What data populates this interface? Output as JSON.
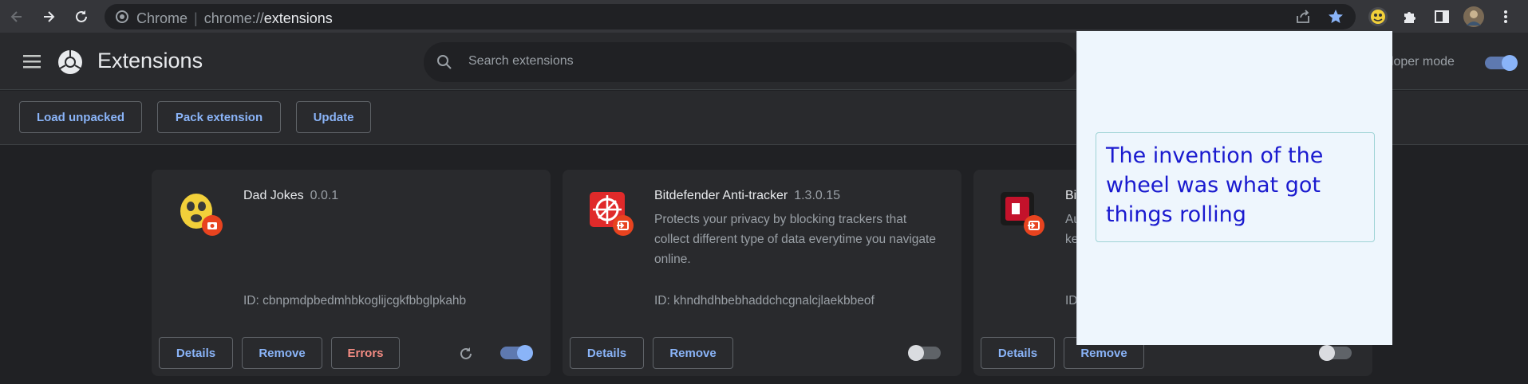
{
  "browser": {
    "omnibox": {
      "scheme": "Chrome",
      "separator": "|",
      "url_prefix": "chrome://",
      "url_host": "extensions"
    }
  },
  "header": {
    "title": "Extensions",
    "search_placeholder": "Search extensions",
    "developer_mode_label": "eloper mode",
    "developer_mode_on": true
  },
  "toolbar": {
    "load_unpacked": "Load unpacked",
    "pack_extension": "Pack extension",
    "update": "Update"
  },
  "extensions": [
    {
      "name": "Dad Jokes",
      "version": "0.0.1",
      "description": "",
      "id_text": "ID: cbnpmdpbedmhbkoglijcgkfbbglpkahb",
      "details": "Details",
      "remove": "Remove",
      "errors": "Errors",
      "enabled": true
    },
    {
      "name": "Bitdefender Anti-tracker",
      "version": "1.3.0.15",
      "description": "Protects your privacy by blocking trackers that collect different type of data everytime you navigate online.",
      "id_text": "ID: khndhdhbebhaddchcgnalcjlaekbbeof",
      "details": "Details",
      "remove": "Remove",
      "enabled": false
    },
    {
      "name": "Bi",
      "version": "",
      "description_line1": "Au",
      "description_line2": "ke",
      "id_text": "ID",
      "details": "Details",
      "remove": "Remove",
      "enabled": false
    }
  ],
  "popup": {
    "joke": "The invention of the wheel was what got things rolling"
  },
  "colors": {
    "accent": "#8ab4f8",
    "error": "#f28b82",
    "popup_bg": "#eef6fd",
    "joke_text": "#1a1acf"
  }
}
